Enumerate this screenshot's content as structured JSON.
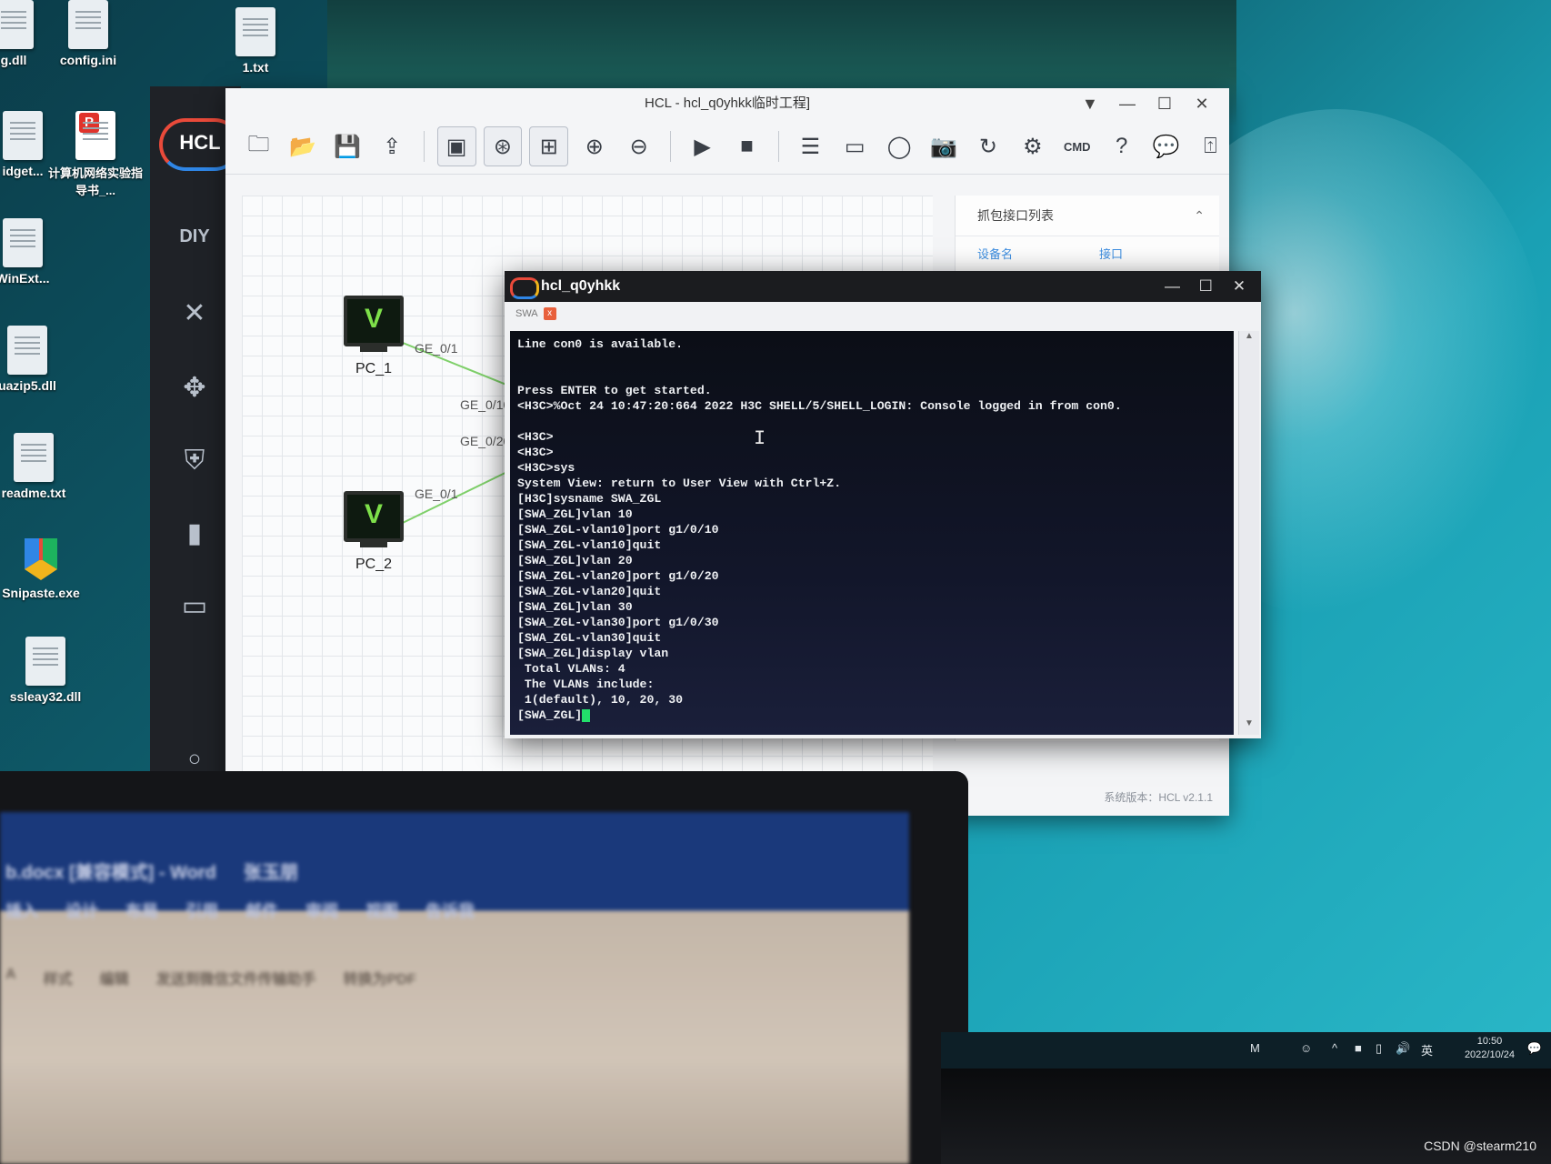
{
  "desktop": {
    "icons": [
      {
        "label": "g.dll",
        "name": "desk-icon-g-dll"
      },
      {
        "label": "config.ini",
        "name": "desk-icon-config-ini"
      },
      {
        "label": "1.txt",
        "name": "desk-icon-1-txt"
      },
      {
        "label": "idget...",
        "name": "desk-icon-widget"
      },
      {
        "label": "计算机网络实验指导书_...",
        "name": "desk-icon-pdf"
      },
      {
        "label": "WinExt...",
        "name": "desk-icon-winext"
      },
      {
        "label": "uazip5.dll",
        "name": "desk-icon-quazip5-dll"
      },
      {
        "label": "readme.txt",
        "name": "desk-icon-readme-txt"
      },
      {
        "label": "Snipaste.exe",
        "name": "desk-icon-snipaste"
      },
      {
        "label": "ssleay32.dll",
        "name": "desk-icon-ssleay32"
      }
    ]
  },
  "hcl": {
    "logo": "HCL",
    "sidebar_diy": "DIY",
    "title": "HCL - hcl_q0yhkk临时工程]",
    "controls": {
      "min": "—",
      "max": "☐",
      "close": "✕",
      "menu": "▼"
    },
    "toolbar_cmd": "CMD",
    "canvas": {
      "pc1": {
        "label": "PC_1",
        "port": "GE_0/1"
      },
      "pc2": {
        "label": "PC_2",
        "port": "GE_0/1"
      },
      "sw_port1": "GE_0/10",
      "sw_port2": "GE_0/20"
    },
    "capture_panel": {
      "title": "抓包接口列表",
      "arrow": "⌃",
      "col_device": "设备名",
      "col_port": "接口"
    },
    "version": "系统版本：HCL v2.1.1"
  },
  "terminal": {
    "title": "hcl_q0yhkk",
    "tab": "SWA",
    "tab_close": "x",
    "lines": [
      "Line con0 is available.",
      "",
      "",
      "Press ENTER to get started.",
      "<H3C>%Oct 24 10:47:20:664 2022 H3C SHELL/5/SHELL_LOGIN: Console logged in from con0.",
      "",
      "<H3C>",
      "<H3C>",
      "<H3C>sys",
      "System View: return to User View with Ctrl+Z.",
      "[H3C]sysname SWA_ZGL",
      "[SWA_ZGL]vlan 10",
      "[SWA_ZGL-vlan10]port g1/0/10",
      "[SWA_ZGL-vlan10]quit",
      "[SWA_ZGL]vlan 20",
      "[SWA_ZGL-vlan20]port g1/0/20",
      "[SWA_ZGL-vlan20]quit",
      "[SWA_ZGL]vlan 30",
      "[SWA_ZGL-vlan30]port g1/0/30",
      "[SWA_ZGL-vlan30]quit",
      "[SWA_ZGL]display vlan",
      " Total VLANs: 4",
      " The VLANs include:",
      " 1(default), 10, 20, 30"
    ],
    "prompt": "[SWA_ZGL]",
    "ibeam": "I"
  },
  "laptop": {
    "row1": [
      "b.docx [兼容模式] - Word",
      "张玉朋",
      "",
      "",
      ""
    ],
    "row2": [
      "插入",
      "设计",
      "布局",
      "引用",
      "邮件",
      "审阅",
      "视图",
      "告诉我"
    ],
    "row3": [
      "A",
      "样式",
      "编辑",
      "发送到微信文件传输助手",
      "转换为PDF"
    ]
  },
  "taskbar": {
    "ime": "M",
    "lang": "英",
    "time": "10:50",
    "date": "2022/10/24"
  },
  "watermark": "CSDN @stearm210"
}
